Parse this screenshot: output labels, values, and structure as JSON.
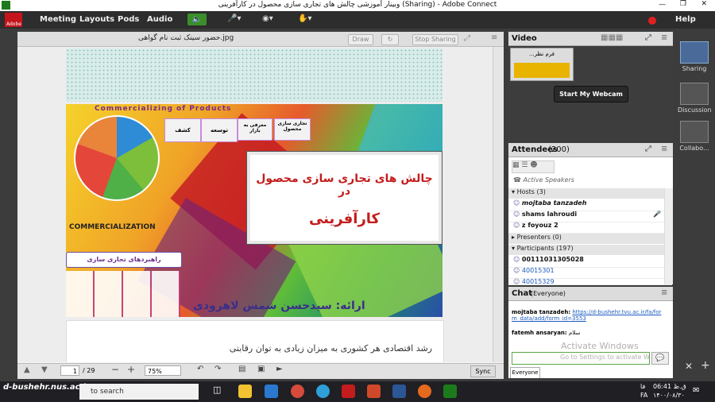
{
  "window": {
    "title": "وبینار آموزشی چالش های تجاری سازی محصول در کارآفرینی (Sharing) - Adobe Connect"
  },
  "menubar": {
    "items": [
      "Meeting",
      "Layouts",
      "Pods",
      "Audio"
    ],
    "help": "Help",
    "adobe": "Adobe"
  },
  "share": {
    "file_name": "حضور سینک ثبت نام گواهی.jpg",
    "draw_label": "Draw",
    "stop_label": "Stop Sharing",
    "slide_title_line1": "چالش های تجاری سازی محصول در",
    "slide_title_line2": "کارآفرینی",
    "slide_presenter": "ارائه: سیدحسن شمس لاهرودی",
    "slide_banner": "Commercializing of Products",
    "slide_commercialization": "COMMERCIALIZATION",
    "slide_strategy": "راهبردهای تجاری سازی",
    "steps": [
      "تجاری سازی محصول",
      "معرفی به بازار",
      "توسعه",
      "کشف"
    ],
    "next_slide_text": "رشد اقتصادی هر کشوری به میزان زیادی به توان رقابتی",
    "page_current": "1",
    "page_total": "/ 29",
    "zoom": "75%",
    "sync": "Sync"
  },
  "video": {
    "title": "Video",
    "thumb_label": "...فرم نظر",
    "start_webcam": "Start My Webcam"
  },
  "attendees": {
    "title": "Attendees",
    "count": "(200)",
    "active_speakers": "Active Speakers",
    "hosts_label": "Hosts (3)",
    "hosts": [
      "mojtaba tanzadeh",
      "shams lahroudi",
      "z foyouz 2"
    ],
    "presenters_label": "Presenters (0)",
    "participants_label": "Participants (197)",
    "participants": [
      "00111031305028",
      "40015301",
      "40015329"
    ]
  },
  "chat": {
    "title": "Chat",
    "scope": "(Everyone)",
    "messages": [
      {
        "sender": "mojtaba tanzadeh:",
        "text": "https://d-bushehr.tvu.ac.ir/fa/form_data/add/form_id=3553"
      },
      {
        "sender": "fatemh ansaryan:",
        "text": "سلام"
      }
    ],
    "tab": "Everyone",
    "watermark1": "Activate Windows",
    "watermark2": "Go to Settings to activate Windows."
  },
  "sidebar": {
    "items": [
      "Sharing",
      "Discussion",
      "Collabo..."
    ]
  },
  "taskbar": {
    "search_placeholder": "to search",
    "watermark": "d-bushehr.nus.ac.ir",
    "clock_time": "06:41 ق.ظ",
    "clock_date": "۱۴۰۰/۰۸/۳۰",
    "lang": "FA",
    "lang2": "فا"
  },
  "colors": {
    "accent": "#d62b1e",
    "chat_link": "#1d5cbf",
    "menubar": "#2d2d2d"
  }
}
